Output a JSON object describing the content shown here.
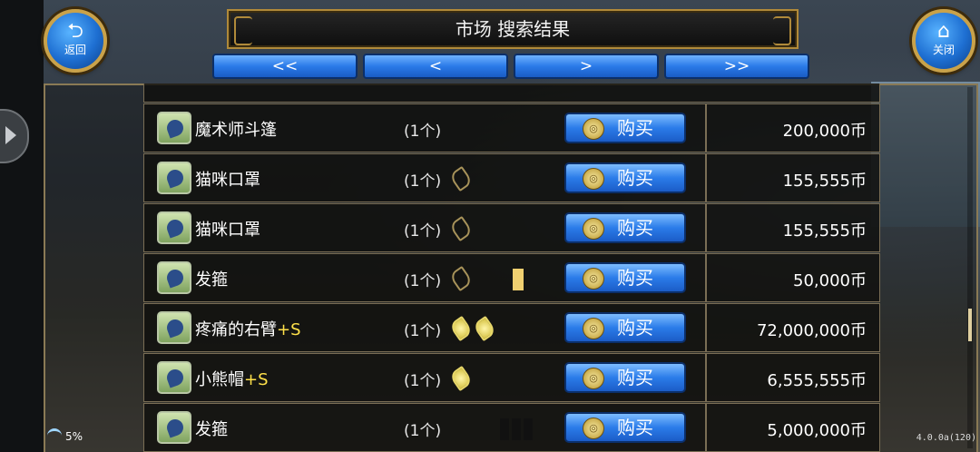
{
  "header": {
    "title": "市场 搜索结果"
  },
  "back_button": {
    "icon": "back-arrow-icon",
    "label": "返回"
  },
  "close_button": {
    "icon": "home-icon",
    "label": "关闭"
  },
  "pager": {
    "first": "<<",
    "prev": "<",
    "next": ">",
    "last": ">>"
  },
  "buy_label": "购买",
  "items": [
    {
      "name": "魔术师斗篷",
      "suffix": "",
      "qty": "(1个)",
      "price": "200,000币",
      "slots": []
    },
    {
      "name": "猫咪口罩",
      "suffix": "",
      "qty": "(1个)",
      "price": "155,555币",
      "slots": [
        "empty"
      ]
    },
    {
      "name": "猫咪口罩",
      "suffix": "",
      "qty": "(1个)",
      "price": "155,555币",
      "slots": [
        "empty"
      ]
    },
    {
      "name": "发箍",
      "suffix": "",
      "qty": "(1个)",
      "price": "50,000币",
      "slots": [
        "empty"
      ],
      "marker": "yellow"
    },
    {
      "name": "疼痛的右臂",
      "suffix": "+S",
      "qty": "(1个)",
      "price": "72,000,000币",
      "slots": [
        "filled",
        "filled"
      ]
    },
    {
      "name": "小熊帽",
      "suffix": "+S",
      "qty": "(1个)",
      "price": "6,555,555币",
      "slots": [
        "filled"
      ]
    },
    {
      "name": "发箍",
      "suffix": "",
      "qty": "(1个)",
      "price": "5,000,000币",
      "slots": [],
      "marker": "black"
    }
  ],
  "status": {
    "battery": "5%",
    "version": "4.0.0a(120)"
  },
  "colors": {
    "accent_gold": "#b08a3a",
    "button_blue": "#2b7ce9",
    "suffix_yellow": "#ffe14a"
  }
}
